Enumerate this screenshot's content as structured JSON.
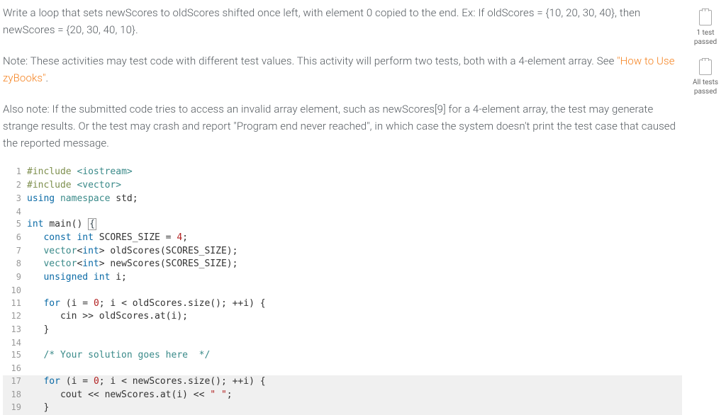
{
  "instructions": {
    "p1": "Write a loop that sets newScores to oldScores shifted once left, with element 0 copied to the end. Ex: If oldScores = {10, 20, 30, 40}, then newScores = {20, 30, 40, 10}.",
    "p2_prefix": "Note: These activities may test code with different test values. This activity will perform two tests, both with a 4-element array. See ",
    "p2_link": "\"How to Use zyBooks\"",
    "p2_suffix": ".",
    "p3": "Also note: If the submitted code tries to access an invalid array element, such as newScores[9] for a 4-element array, the test may generate strange results. Or the test may crash and report \"Program end never reached\", in which case the system doesn't print the test case that caused the reported message."
  },
  "code": {
    "lines": [
      {
        "n": 1,
        "seg": [
          {
            "c": "tok-pre",
            "t": "#include "
          },
          {
            "c": "tok-type",
            "t": "<iostream>"
          }
        ]
      },
      {
        "n": 2,
        "seg": [
          {
            "c": "tok-pre",
            "t": "#include "
          },
          {
            "c": "tok-type",
            "t": "<vector>"
          }
        ]
      },
      {
        "n": 3,
        "seg": [
          {
            "c": "tok-kw",
            "t": "using "
          },
          {
            "c": "tok-type",
            "t": "namespace "
          },
          {
            "c": "tok-id",
            "t": "std;"
          }
        ]
      },
      {
        "n": 4,
        "seg": []
      },
      {
        "n": 5,
        "seg": [
          {
            "c": "tok-kw",
            "t": "int "
          },
          {
            "c": "tok-id",
            "t": "main() "
          },
          {
            "c": "cur-box",
            "t": "{"
          }
        ]
      },
      {
        "n": 6,
        "seg": [
          {
            "c": "",
            "t": "   "
          },
          {
            "c": "tok-kw",
            "t": "const int "
          },
          {
            "c": "tok-id",
            "t": "SCORES_SIZE = "
          },
          {
            "c": "tok-num",
            "t": "4"
          },
          {
            "c": "tok-id",
            "t": ";"
          }
        ]
      },
      {
        "n": 7,
        "seg": [
          {
            "c": "",
            "t": "   "
          },
          {
            "c": "tok-type",
            "t": "vector"
          },
          {
            "c": "tok-id",
            "t": "<"
          },
          {
            "c": "tok-kw",
            "t": "int"
          },
          {
            "c": "tok-id",
            "t": "> oldScores(SCORES_SIZE);"
          }
        ]
      },
      {
        "n": 8,
        "seg": [
          {
            "c": "",
            "t": "   "
          },
          {
            "c": "tok-type",
            "t": "vector"
          },
          {
            "c": "tok-id",
            "t": "<"
          },
          {
            "c": "tok-kw",
            "t": "int"
          },
          {
            "c": "tok-id",
            "t": "> newScores(SCORES_SIZE);"
          }
        ]
      },
      {
        "n": 9,
        "seg": [
          {
            "c": "",
            "t": "   "
          },
          {
            "c": "tok-kw",
            "t": "unsigned int "
          },
          {
            "c": "tok-id",
            "t": "i;"
          }
        ]
      },
      {
        "n": 10,
        "seg": []
      },
      {
        "n": 11,
        "seg": [
          {
            "c": "",
            "t": "   "
          },
          {
            "c": "tok-kw",
            "t": "for "
          },
          {
            "c": "tok-id",
            "t": "(i = "
          },
          {
            "c": "tok-num",
            "t": "0"
          },
          {
            "c": "tok-id",
            "t": "; i < oldScores.size(); ++i) {"
          }
        ]
      },
      {
        "n": 12,
        "seg": [
          {
            "c": "",
            "t": "      "
          },
          {
            "c": "tok-id",
            "t": "cin >> oldScores.at(i);"
          }
        ]
      },
      {
        "n": 13,
        "seg": [
          {
            "c": "",
            "t": "   "
          },
          {
            "c": "tok-id",
            "t": "}"
          }
        ]
      },
      {
        "n": 14,
        "seg": []
      },
      {
        "n": 15,
        "seg": [
          {
            "c": "",
            "t": "   "
          },
          {
            "c": "tok-cmt",
            "t": "/* Your solution goes here  */"
          }
        ]
      },
      {
        "n": 16,
        "seg": []
      },
      {
        "n": 17,
        "hl": true,
        "seg": [
          {
            "c": "",
            "t": "   "
          },
          {
            "c": "tok-kw",
            "t": "for "
          },
          {
            "c": "tok-id",
            "t": "(i = "
          },
          {
            "c": "tok-num",
            "t": "0"
          },
          {
            "c": "tok-id",
            "t": "; i < newScores.size(); ++i) {"
          }
        ]
      },
      {
        "n": 18,
        "hl": true,
        "seg": [
          {
            "c": "",
            "t": "      "
          },
          {
            "c": "tok-id",
            "t": "cout << newScores.at(i) << "
          },
          {
            "c": "tok-str",
            "t": "\" \""
          },
          {
            "c": "tok-id",
            "t": ";"
          }
        ]
      },
      {
        "n": 19,
        "hl": true,
        "seg": [
          {
            "c": "",
            "t": "   "
          },
          {
            "c": "tok-id",
            "t": "}"
          }
        ]
      }
    ]
  },
  "sidebar": {
    "status1_line1": "1 test",
    "status1_line2": "passed",
    "status2_line1": "All tests",
    "status2_line2": "passed"
  }
}
